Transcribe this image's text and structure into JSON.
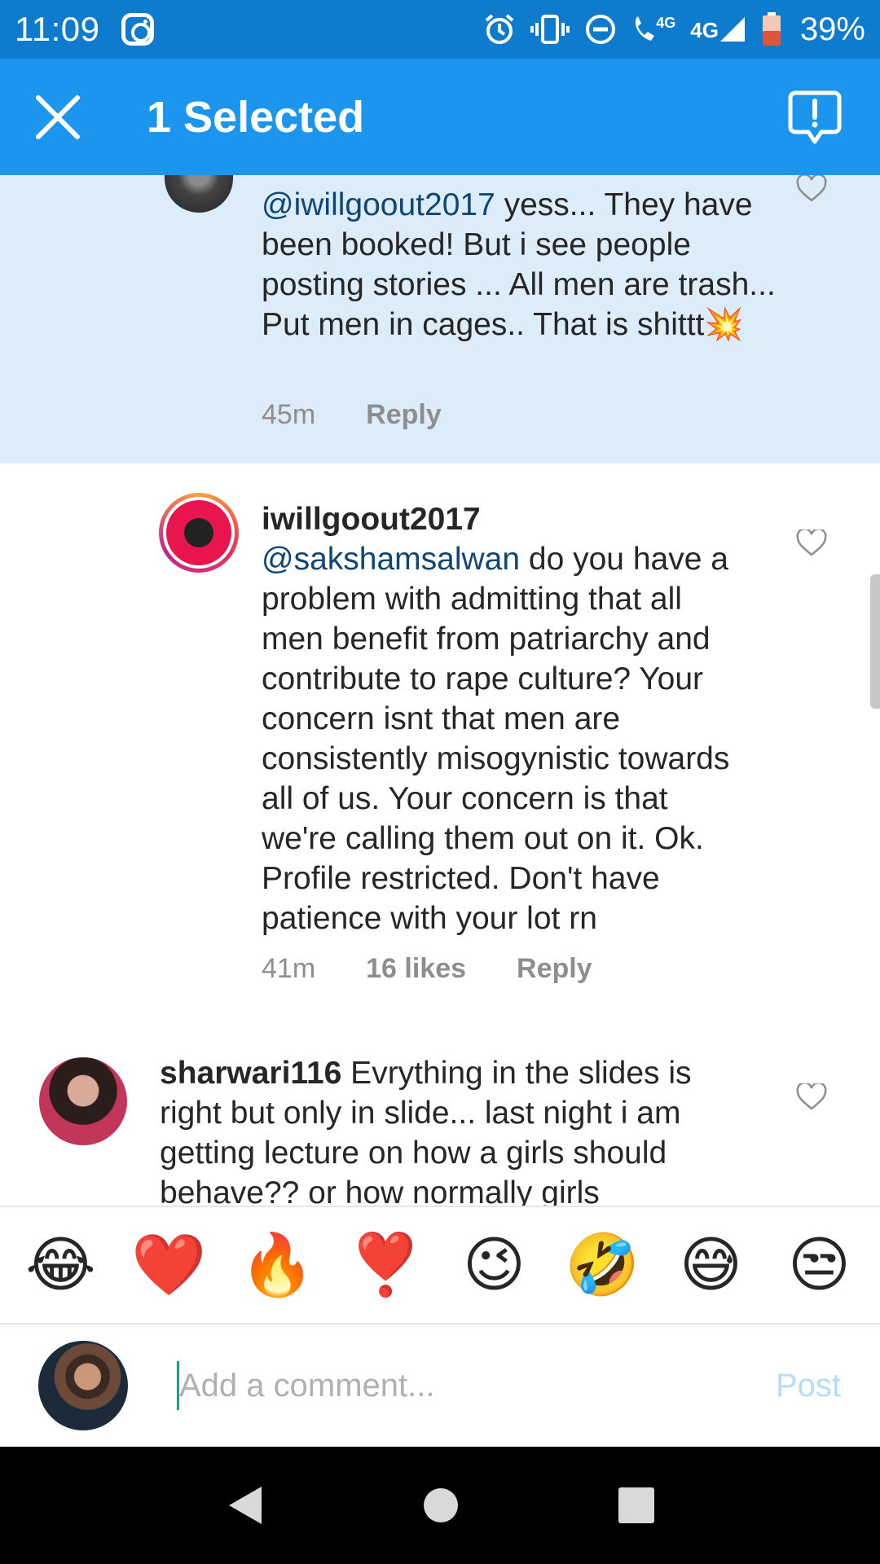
{
  "status_bar": {
    "time": "11:09",
    "network_small": "4G",
    "network": "4G",
    "battery": "39%"
  },
  "app_bar": {
    "title": "1 Selected"
  },
  "comments": [
    {
      "username": "",
      "mention": "@iwillgoout2017",
      "text": " yess... They have been booked! But i see people posting stories ... All men are trash... Put men in cages.. That is shittt💥",
      "time": "45m",
      "likes": "",
      "reply_label": "Reply",
      "selected": true
    },
    {
      "username": "iwillgoout2017",
      "mention": "@sakshamsalwan",
      "text": " do you have a problem with admitting that all men benefit from patriarchy and contribute to rape culture? Your concern isnt that men are consistently misogynistic towards all of us. Your concern is that we're calling them out on it. Ok. Profile restricted. Don't have patience with your lot rn",
      "time": "41m",
      "likes": "16 likes",
      "reply_label": "Reply",
      "selected": false
    },
    {
      "username": "sharwari116",
      "mention": "",
      "text": " Evrything in the slides is right but only in slide... last night i am getting lecture on how a girls should behave?? or how normally girls",
      "selected": false
    }
  ],
  "emoji_bar": [
    "😂",
    "❤️",
    "🔥",
    "❣️",
    "😉",
    "🤣",
    "😅",
    "😒"
  ],
  "comment_box": {
    "placeholder": "Add a comment...",
    "post_label": "Post"
  },
  "colors": {
    "status_bar": "#0f7bcf",
    "app_bar": "#1b95ee",
    "selected_bg": "#dcecf9",
    "mention": "#0e4675",
    "post_disabled": "#b6dcf8"
  }
}
